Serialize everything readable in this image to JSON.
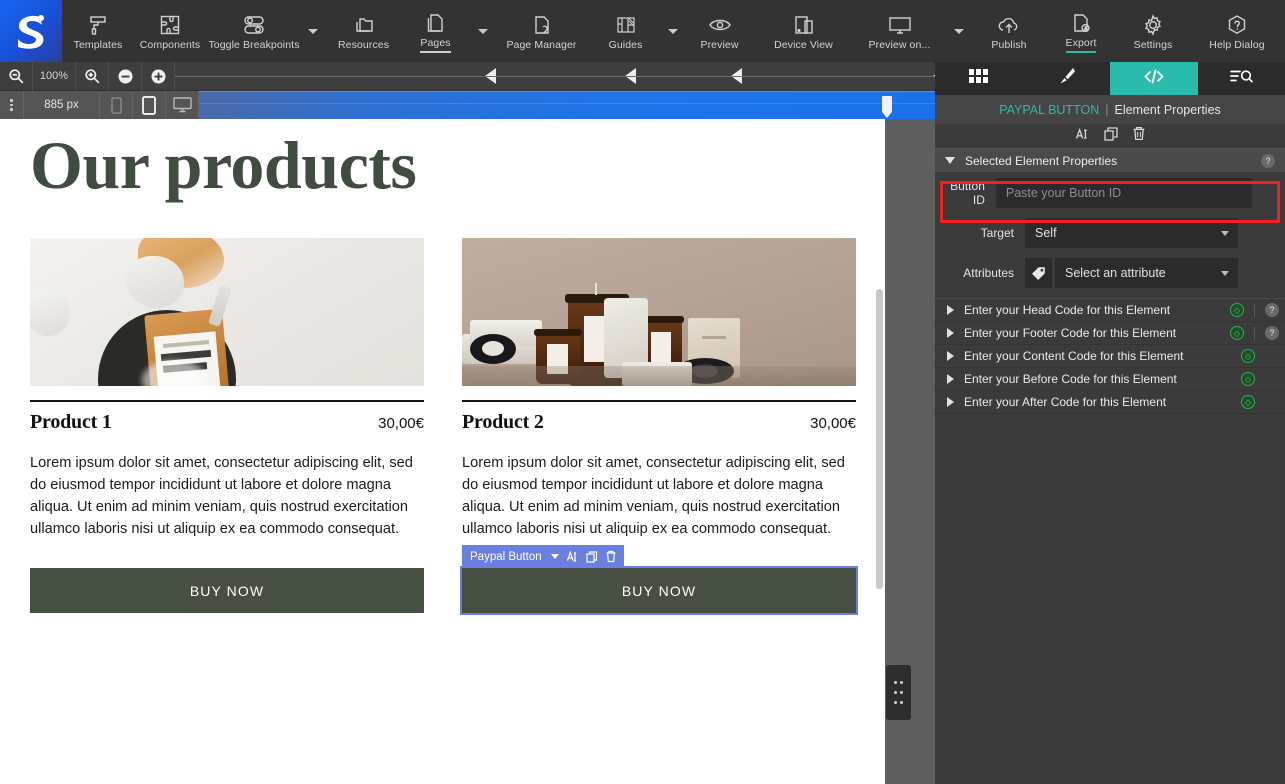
{
  "toolbar": {
    "logo_icon": "app-logo-icon",
    "left_items": [
      {
        "label": "Templates",
        "icon": "paint-roller-icon",
        "caret": false
      },
      {
        "label": "Components",
        "icon": "puzzle-icon",
        "caret": false
      },
      {
        "label": "Toggle Breakpoints",
        "icon": "breakpoints-icon",
        "caret": true
      }
    ],
    "center_items": [
      {
        "label": "Resources",
        "icon": "folders-icon",
        "caret": false,
        "active": false
      },
      {
        "label": "Pages",
        "icon": "pages-icon",
        "caret": true,
        "active": true
      },
      {
        "label": "Page Manager",
        "icon": "page-manager-icon",
        "caret": false,
        "active": false
      },
      {
        "label": "Guides",
        "icon": "guides-icon",
        "caret": true,
        "active": false
      },
      {
        "label": "Preview",
        "icon": "eye-icon",
        "caret": false,
        "active": false
      },
      {
        "label": "Device View",
        "icon": "device-view-icon",
        "caret": false,
        "active": false
      },
      {
        "label": "Preview on...",
        "icon": "monitor-icon",
        "caret": true,
        "active": false
      }
    ],
    "right_items": [
      {
        "label": "Publish",
        "icon": "publish-cloud-icon",
        "active": false
      },
      {
        "label": "Export",
        "icon": "export-file-icon",
        "active": true
      },
      {
        "label": "Settings",
        "icon": "gear-icon",
        "active": false
      },
      {
        "label": "Help Dialog",
        "icon": "help-hexagon-icon",
        "active": false
      }
    ]
  },
  "ruler": {
    "zoom_out_icon": "zoom-out-magnifier-icon",
    "zoom_level": "100%",
    "zoom_in_icon": "zoom-in-magnifier-icon",
    "minus_icon": "minus-circle-icon",
    "plus_icon": "plus-circle-icon",
    "breakpoint_markers": [
      322,
      462,
      568,
      770
    ]
  },
  "breakpoint_bar": {
    "kebab_icon": "kebab-menu-icon",
    "width_value": "885 px",
    "devices": [
      {
        "icon": "phone-icon",
        "active": false
      },
      {
        "icon": "tablet-icon",
        "active": true
      },
      {
        "icon": "desktop-icon",
        "active": false
      }
    ],
    "handle_icon": "breakpoint-handle-icon"
  },
  "canvas": {
    "page_title": "Our products",
    "products": [
      {
        "image_alt": "serum bottle with crystals",
        "name": "Product 1",
        "price": "30,00€",
        "description": "Lorem ipsum dolor sit amet, consectetur adipiscing elit, sed do eiusmod tempor incididunt ut labore et dolore magna aliqua. Ut enim ad minim veniam, quis nostrud exercitation ullamco laboris nisi ut aliquip ex ea commodo consequat.",
        "button_label": "BUY NOW",
        "selected": false
      },
      {
        "image_alt": "amber candle jars on stone",
        "name": "Product 2",
        "price": "30,00€",
        "description": "Lorem ipsum dolor sit amet, consectetur adipiscing elit, sed do eiusmod tempor incididunt ut labore et dolore magna aliqua. Ut enim ad minim veniam, quis nostrud exercitation ullamco laboris nisi ut aliquip ex ea commodo consequat.",
        "button_label": "BUY NOW",
        "selected": true
      }
    ],
    "selection_badge": {
      "label": "Paypal Button",
      "caret_icon": "chevron-down-icon",
      "text_icon": "text-cursor-icon",
      "duplicate_icon": "duplicate-icon",
      "delete_icon": "trash-icon"
    },
    "scrollbar_icon": "vertical-scrollbar",
    "drag_handle_icon": "dots-drag-handle-icon"
  },
  "panel": {
    "tabs": [
      {
        "icon": "grid-icon",
        "active": false
      },
      {
        "icon": "brush-icon",
        "active": false
      },
      {
        "icon": "code-icon",
        "active": true
      },
      {
        "icon": "filter-search-icon",
        "active": false
      }
    ],
    "title_accent": "PAYPAL BUTTON",
    "title_separator": "|",
    "title_rest": "Element Properties",
    "actions": [
      {
        "icon": "text-cursor-icon"
      },
      {
        "icon": "duplicate-icon"
      },
      {
        "icon": "trash-icon"
      }
    ],
    "section_title": "Selected Element Properties",
    "section_help": "?",
    "fields": {
      "button_id_label": "Button ID",
      "button_id_value": "",
      "button_id_placeholder": "Paste your Button ID",
      "target_label": "Target",
      "target_value": "Self",
      "attributes_label": "Attributes",
      "attributes_icon": "tag-icon",
      "attributes_value": "Select an attribute"
    },
    "highlight_color": "#f41f1f",
    "accent_color": "#2bbbad",
    "code_rows": [
      {
        "label": "Enter your Head Code for this Element",
        "has_help": true
      },
      {
        "label": "Enter your Footer Code for this Element",
        "has_help": true
      },
      {
        "label": "Enter your Content Code for this Element",
        "has_help": false
      },
      {
        "label": "Enter your Before Code for this Element",
        "has_help": false
      },
      {
        "label": "Enter your After Code for this Element",
        "has_help": false
      }
    ],
    "code_dot_glyph": "◇"
  }
}
